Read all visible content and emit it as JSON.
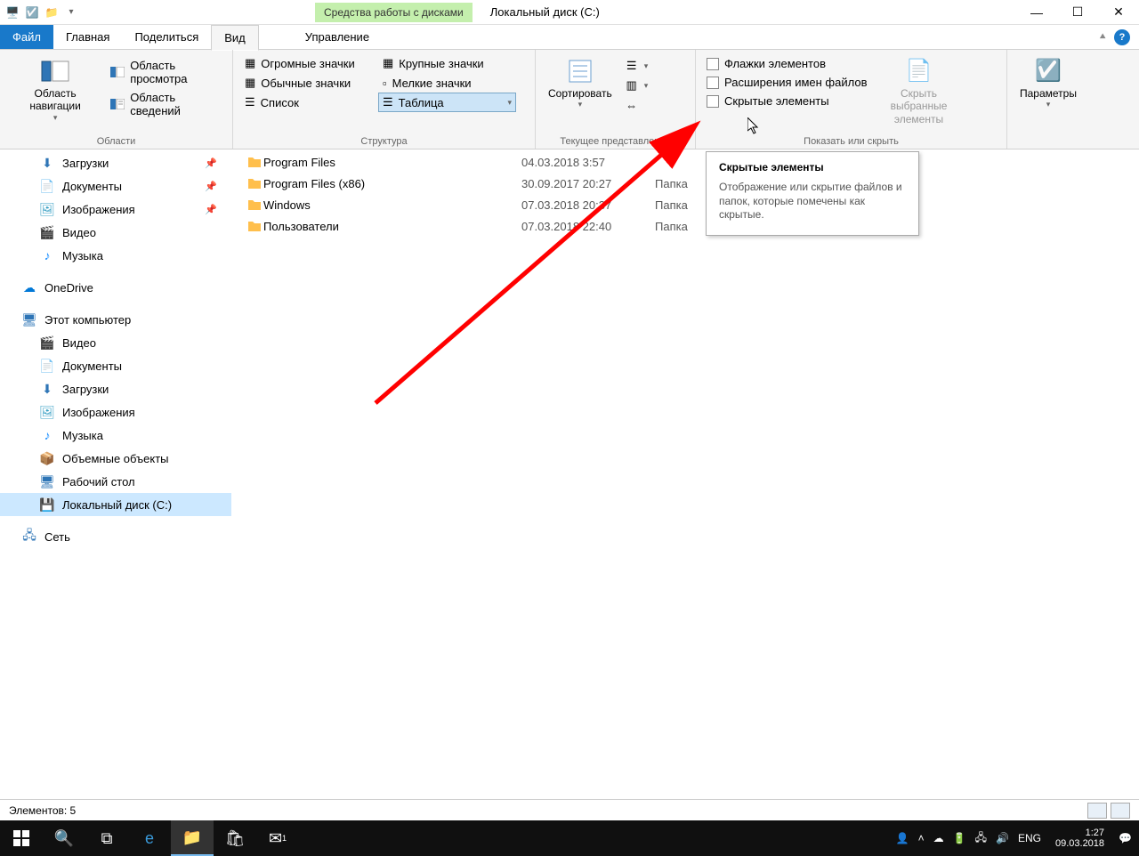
{
  "titlebar": {
    "contextual": "Средства работы с дисками",
    "title": "Локальный диск (C:)"
  },
  "tabs": {
    "file": "Файл",
    "home": "Главная",
    "share": "Поделиться",
    "view": "Вид",
    "manage": "Управление"
  },
  "ribbon": {
    "nav_pane": "Область навигации",
    "preview_pane": "Область просмотра",
    "details_pane": "Область сведений",
    "group_areas": "Области",
    "huge_icons": "Огромные значки",
    "large_icons": "Крупные значки",
    "normal_icons": "Обычные значки",
    "small_icons": "Мелкие значки",
    "list": "Список",
    "table": "Таблица",
    "group_layout": "Структура",
    "sort": "Сортировать",
    "group_current": "Текущее представление",
    "flags": "Флажки элементов",
    "extensions": "Расширения имен файлов",
    "hidden": "Скрытые элементы",
    "hide_selected": "Скрыть выбранные элементы",
    "params": "Параметры",
    "group_show": "Показать или скрыть"
  },
  "tooltip": {
    "title": "Скрытые элементы",
    "body": "Отображение или скрытие файлов и папок, которые помечены как скрытые."
  },
  "sidebar": {
    "downloads": "Загрузки",
    "documents": "Документы",
    "pictures": "Изображения",
    "videos": "Видео",
    "music": "Музыка",
    "onedrive": "OneDrive",
    "this_pc": "Этот компьютер",
    "p_videos": "Видео",
    "p_documents": "Документы",
    "p_downloads": "Загрузки",
    "p_pictures": "Изображения",
    "p_music": "Музыка",
    "p_3d": "Объемные объекты",
    "p_desktop": "Рабочий стол",
    "p_cdrive": "Локальный диск (C:)",
    "network": "Сеть"
  },
  "files": [
    {
      "name": "Program Files",
      "date": "04.03.2018 3:57",
      "type": ""
    },
    {
      "name": "Program Files (x86)",
      "date": "30.09.2017 20:27",
      "type": "Папка"
    },
    {
      "name": "Windows",
      "date": "07.03.2018 20:37",
      "type": "Папка"
    },
    {
      "name": "Пользователи",
      "date": "07.03.2018 22:40",
      "type": "Папка"
    }
  ],
  "statusbar": {
    "count": "Элементов: 5"
  },
  "taskbar": {
    "lang": "ENG",
    "time": "1:27",
    "date": "09.03.2018"
  }
}
